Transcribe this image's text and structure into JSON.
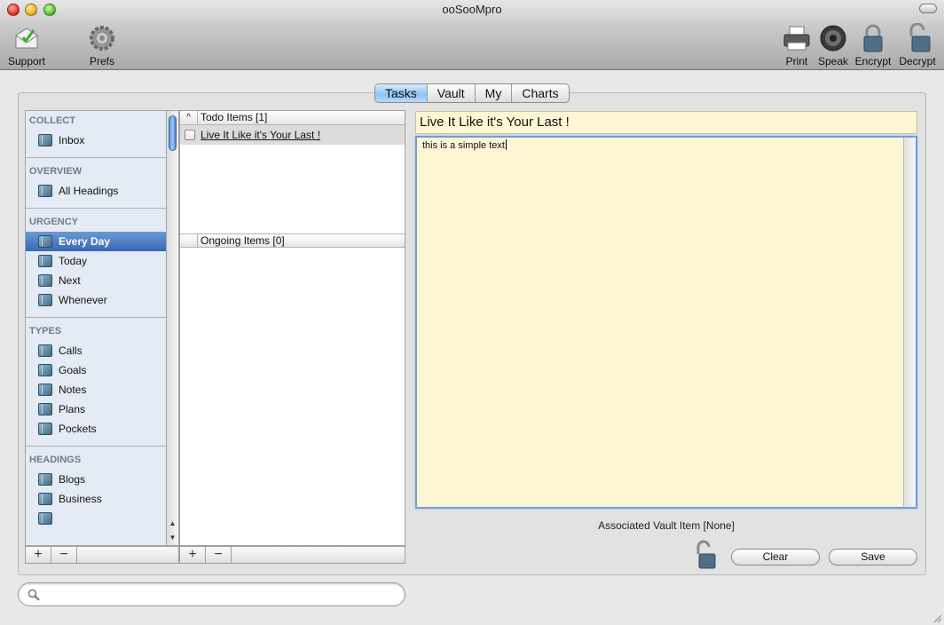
{
  "window": {
    "title": "ooSooMpro"
  },
  "toolbar": {
    "support": "Support",
    "prefs": "Prefs",
    "print": "Print",
    "speak": "Speak",
    "encrypt": "Encrypt",
    "decrypt": "Decrypt"
  },
  "tabs": [
    "Tasks",
    "Vault",
    "My",
    "Charts"
  ],
  "active_tab": "Tasks",
  "sidebar": {
    "groups": [
      {
        "header": "COLLECT",
        "items": [
          "Inbox"
        ]
      },
      {
        "header": "OVERVIEW",
        "items": [
          "All Headings"
        ]
      },
      {
        "header": "URGENCY",
        "items": [
          "Every Day",
          "Today",
          "Next",
          "Whenever"
        ]
      },
      {
        "header": "TYPES",
        "items": [
          "Calls",
          "Goals",
          "Notes",
          "Plans",
          "Pockets"
        ]
      },
      {
        "header": "HEADINGS",
        "items": [
          "Blogs",
          "Business"
        ]
      }
    ],
    "selected": "Every Day"
  },
  "tasklist": {
    "sort_indicator": "^",
    "todo_header": "Todo Items [1]",
    "todo_items": [
      "Live It Like it's Your Last !"
    ],
    "ongoing_header": "Ongoing Items [0]"
  },
  "editor": {
    "title": "Live It Like it's Your Last !",
    "body": "this is a simple text",
    "vault_label": "Associated Vault Item [None]"
  },
  "buttons": {
    "clear": "Clear",
    "save": "Save",
    "add": "+",
    "remove": "−"
  },
  "search": {
    "placeholder": ""
  },
  "colors": {
    "accent": "#3768b4",
    "note_bg": "#fef6d3",
    "selected_tab": "#8fc3f5"
  }
}
